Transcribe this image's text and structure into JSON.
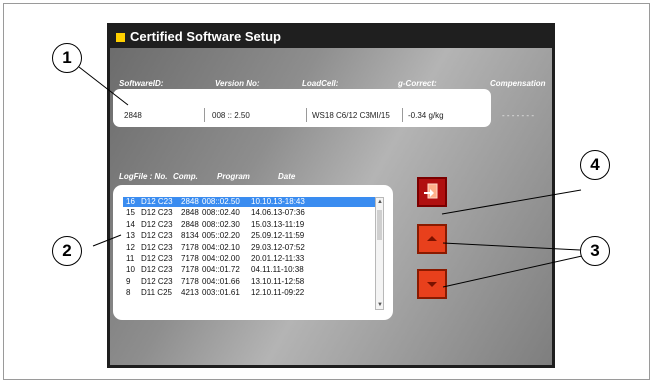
{
  "window": {
    "title": "Certified Software Setup"
  },
  "info": {
    "headers": [
      "SoftwareID:",
      "Version No:",
      "LoadCell:",
      "g-Correct:",
      "Compensation"
    ],
    "values": [
      "2848",
      "008 :: 2.50",
      "WS18 C6/12 C3MI/15",
      "-0.34 g/kg",
      "- - - - - - -"
    ]
  },
  "log": {
    "headers": [
      "LogFile : No.",
      "Comp.",
      "Program",
      "Date"
    ],
    "rows": [
      {
        "no": "16",
        "comp": "D12 C23",
        "id": "2848",
        "prog": "008::02.50",
        "date": "10.10.13-18:43"
      },
      {
        "no": "15",
        "comp": "D12 C23",
        "id": "2848",
        "prog": "008::02.40",
        "date": "14.06.13-07:36"
      },
      {
        "no": "14",
        "comp": "D12 C23",
        "id": "2848",
        "prog": "008::02.30",
        "date": "15.03.13-11:19"
      },
      {
        "no": "13",
        "comp": "D12 C23",
        "id": "8134",
        "prog": "005::02.20",
        "date": "25.09.12-11:59"
      },
      {
        "no": "12",
        "comp": "D12 C23",
        "id": "7178",
        "prog": "004::02.10",
        "date": "29.03.12-07:52"
      },
      {
        "no": "11",
        "comp": "D12 C23",
        "id": "7178",
        "prog": "004::02.00",
        "date": "20.01.12-11:33"
      },
      {
        "no": "10",
        "comp": "D12 C23",
        "id": "7178",
        "prog": "004::01.72",
        "date": "04.11.11-10:38"
      },
      {
        "no": "9",
        "comp": "D12 C23",
        "id": "7178",
        "prog": "004::01.66",
        "date": "13.10.11-12:58"
      },
      {
        "no": "8",
        "comp": "D11 C25",
        "id": "4213",
        "prog": "003::01.61",
        "date": "12.10.11-09:22"
      }
    ],
    "selected_index": 0
  },
  "callouts": {
    "c1": "1",
    "c2": "2",
    "c3": "3",
    "c4": "4"
  },
  "colors": {
    "accent_selection": "#3a8cf0",
    "button_red": "#e8401c",
    "button_darkred": "#b01010",
    "title_icon": "#ffd000"
  },
  "icons": {
    "btn4": "document-export-icon",
    "btn_up": "arrow-up-icon",
    "btn_down": "arrow-down-icon"
  }
}
